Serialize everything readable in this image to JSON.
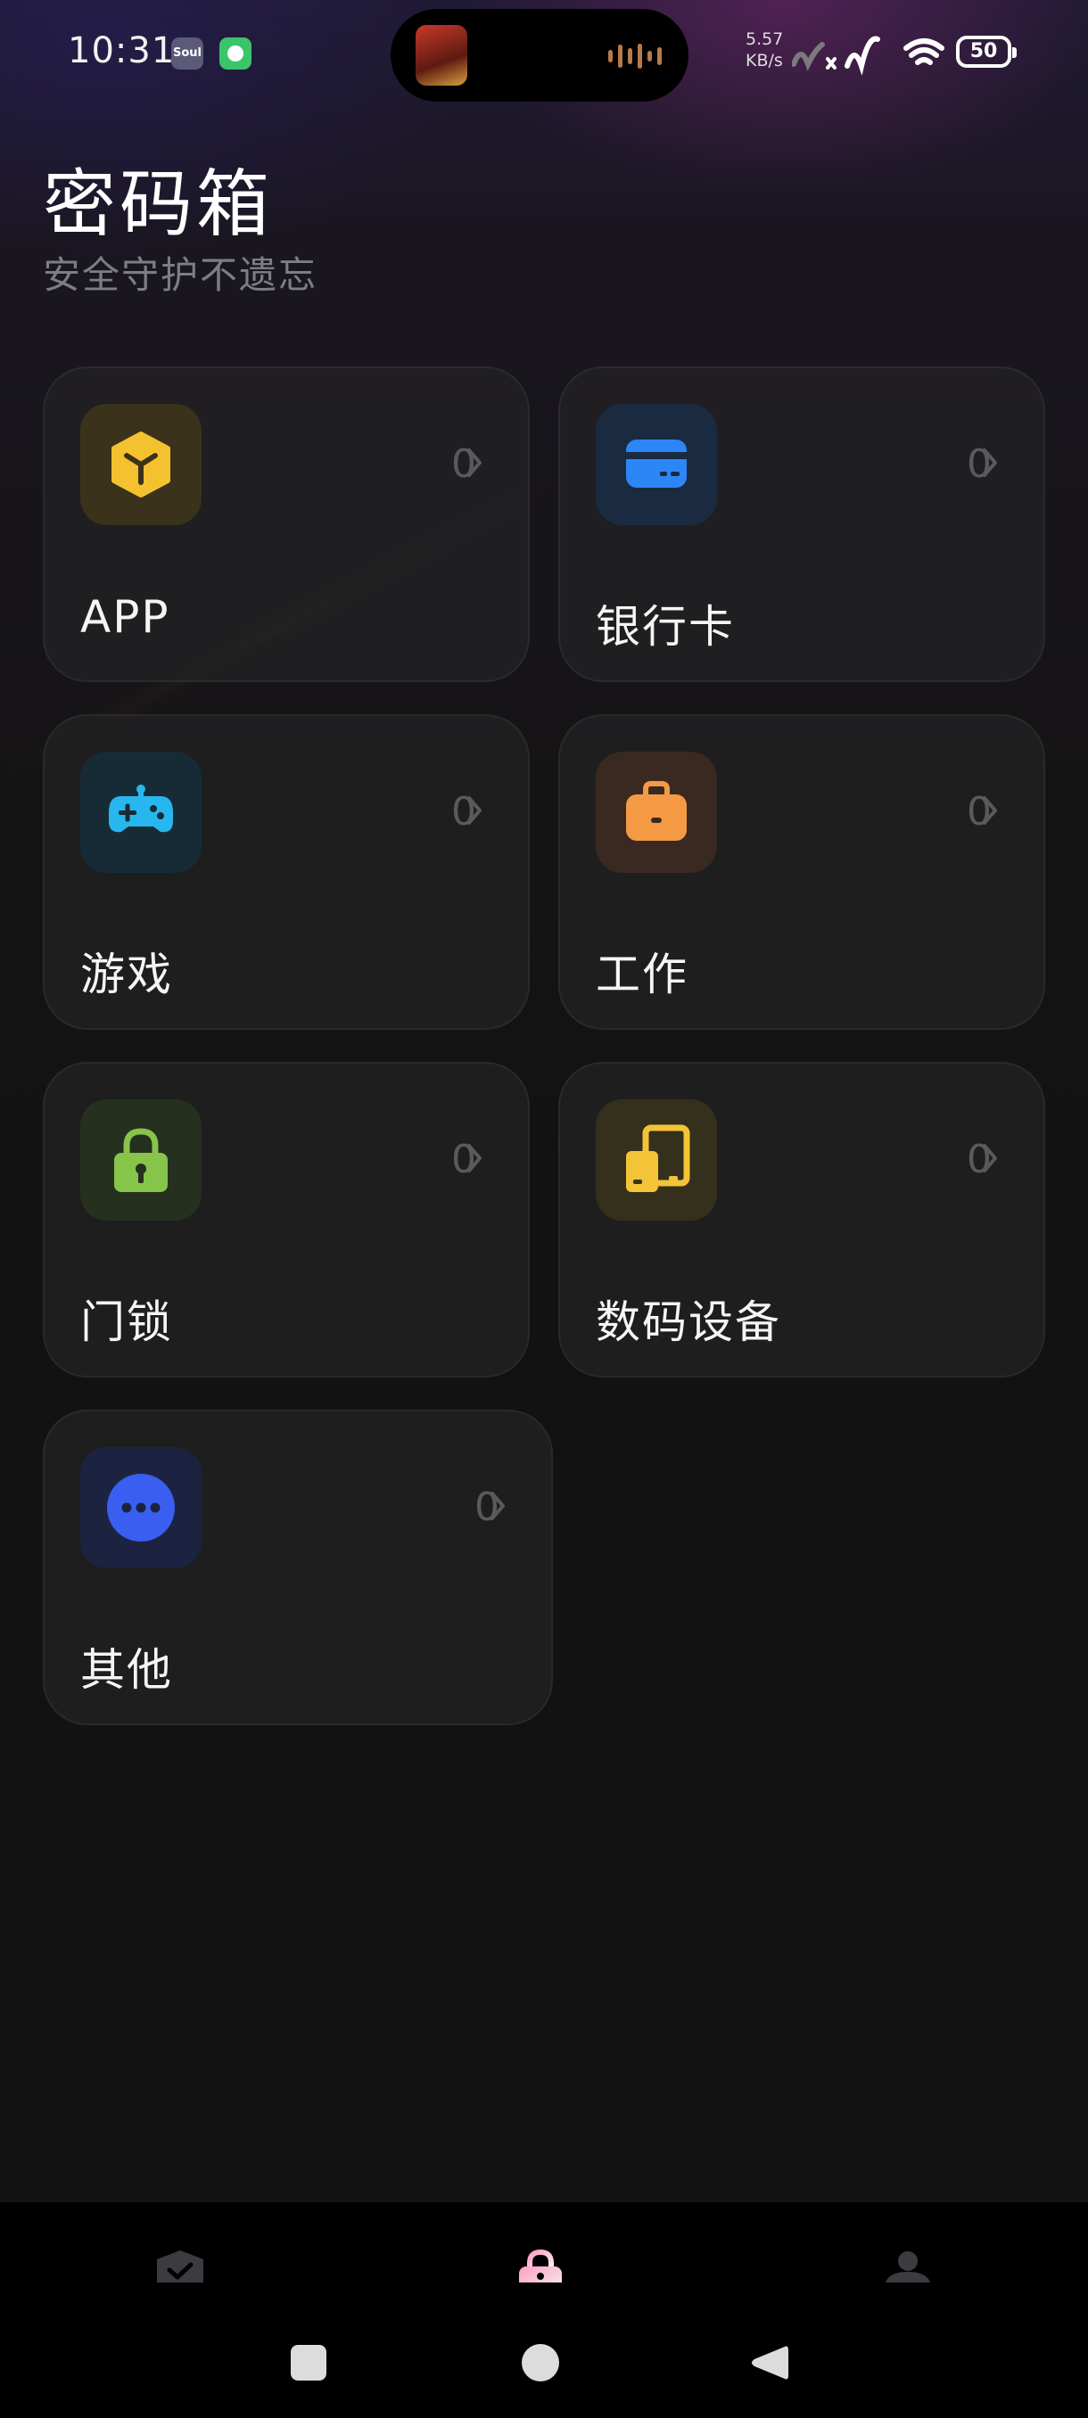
{
  "status_bar": {
    "time": "10:31",
    "soul_label": "Soul",
    "net_speed_value": "5.57",
    "net_speed_unit": "KB/s",
    "battery": "50"
  },
  "header": {
    "title": "密码箱",
    "subtitle": "安全守护不遗忘"
  },
  "categories": [
    {
      "label": "APP",
      "count": "0",
      "icon": "cube-icon",
      "color": "#f4c22e"
    },
    {
      "label": "银行卡",
      "count": "0",
      "icon": "credit-card-icon",
      "color": "#2d86f5"
    },
    {
      "label": "游戏",
      "count": "0",
      "icon": "gamepad-icon",
      "color": "#27b7ef"
    },
    {
      "label": "工作",
      "count": "0",
      "icon": "briefcase-icon",
      "color": "#f49a44"
    },
    {
      "label": "门锁",
      "count": "0",
      "icon": "padlock-icon",
      "color": "#86c54a"
    },
    {
      "label": "数码设备",
      "count": "0",
      "icon": "device-icon",
      "color": "#f3c437"
    },
    {
      "label": "其他",
      "count": "0",
      "icon": "more-dots-icon",
      "color": "#3a5ef0"
    }
  ],
  "bottom_nav": {
    "items": [
      {
        "icon": "shield-check-icon",
        "active": false
      },
      {
        "icon": "lock-icon",
        "active": true
      },
      {
        "icon": "person-icon",
        "active": false
      }
    ]
  },
  "system_nav": [
    "square-icon",
    "circle-icon",
    "back-triangle-icon"
  ]
}
